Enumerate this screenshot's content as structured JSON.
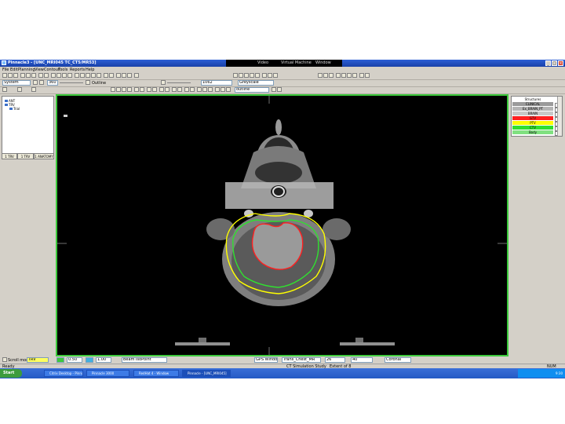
{
  "window": {
    "title": "Pinnacle3 - [UNC_MRI045 TC_CT5/MR53]",
    "menu": [
      "File",
      "Edit",
      "Planning",
      "View",
      "Contour",
      "Tools",
      "Reports",
      "Help"
    ]
  },
  "vm_bar": {
    "left": "Video",
    "center": "Virtual Machine",
    "right": "Window"
  },
  "toolbar": {
    "dataset": "System",
    "window_value": "360",
    "level_label": "Outline",
    "lookup_value": "1062",
    "colormap": "Greyscale",
    "contour_tool": "outline"
  },
  "left_panel": {
    "tree": [
      "ANT",
      "TRV",
      "Trial"
    ],
    "tabs": [
      "1 TRV",
      "1 TRV",
      "1 ANATOMY"
    ]
  },
  "structures": {
    "header": "Structures",
    "rows": [
      {
        "label": "CLINICAL",
        "color": "#9a9a9a"
      },
      {
        "label": "Ex_BRAIN_PT",
        "color": "#b4b4b4"
      },
      {
        "label": "BRAIN",
        "color": "#c8c8c8"
      },
      {
        "label": "GTV",
        "color": "#ff2020"
      },
      {
        "label": "PTV",
        "color": "#ffff00"
      },
      {
        "label": "CTV",
        "color": "#30e030"
      },
      {
        "label": "Body",
        "color": "#80e080"
      }
    ]
  },
  "status": {
    "scroll_mode": "Scroll mode",
    "mode_value": "TRV",
    "thickness": "0.50",
    "zoom": "1.00",
    "point_mode": "Beam IsoPoint",
    "view": "GPS Window",
    "image_set": "Trans_Chest_MR",
    "slice": "26",
    "offset": "40",
    "orientation": "Coronal"
  },
  "status2": {
    "left": "Ready",
    "center": "CT Simulation Study",
    "center2": "Extent of 8",
    "right": "NUM"
  },
  "taskbar": {
    "start": "Start",
    "tasks": [
      "Citrix Desktop - Pinnacle",
      "Pinnacle 3000",
      "RedHat 4 - Window",
      "Pinnacle - [UNC_MRI045]"
    ],
    "clock": "9:30"
  },
  "colors": {
    "viewer_border": "#3cc93c",
    "gtv": "#ff2020",
    "ctv": "#30e030",
    "ptv": "#ffff00"
  }
}
